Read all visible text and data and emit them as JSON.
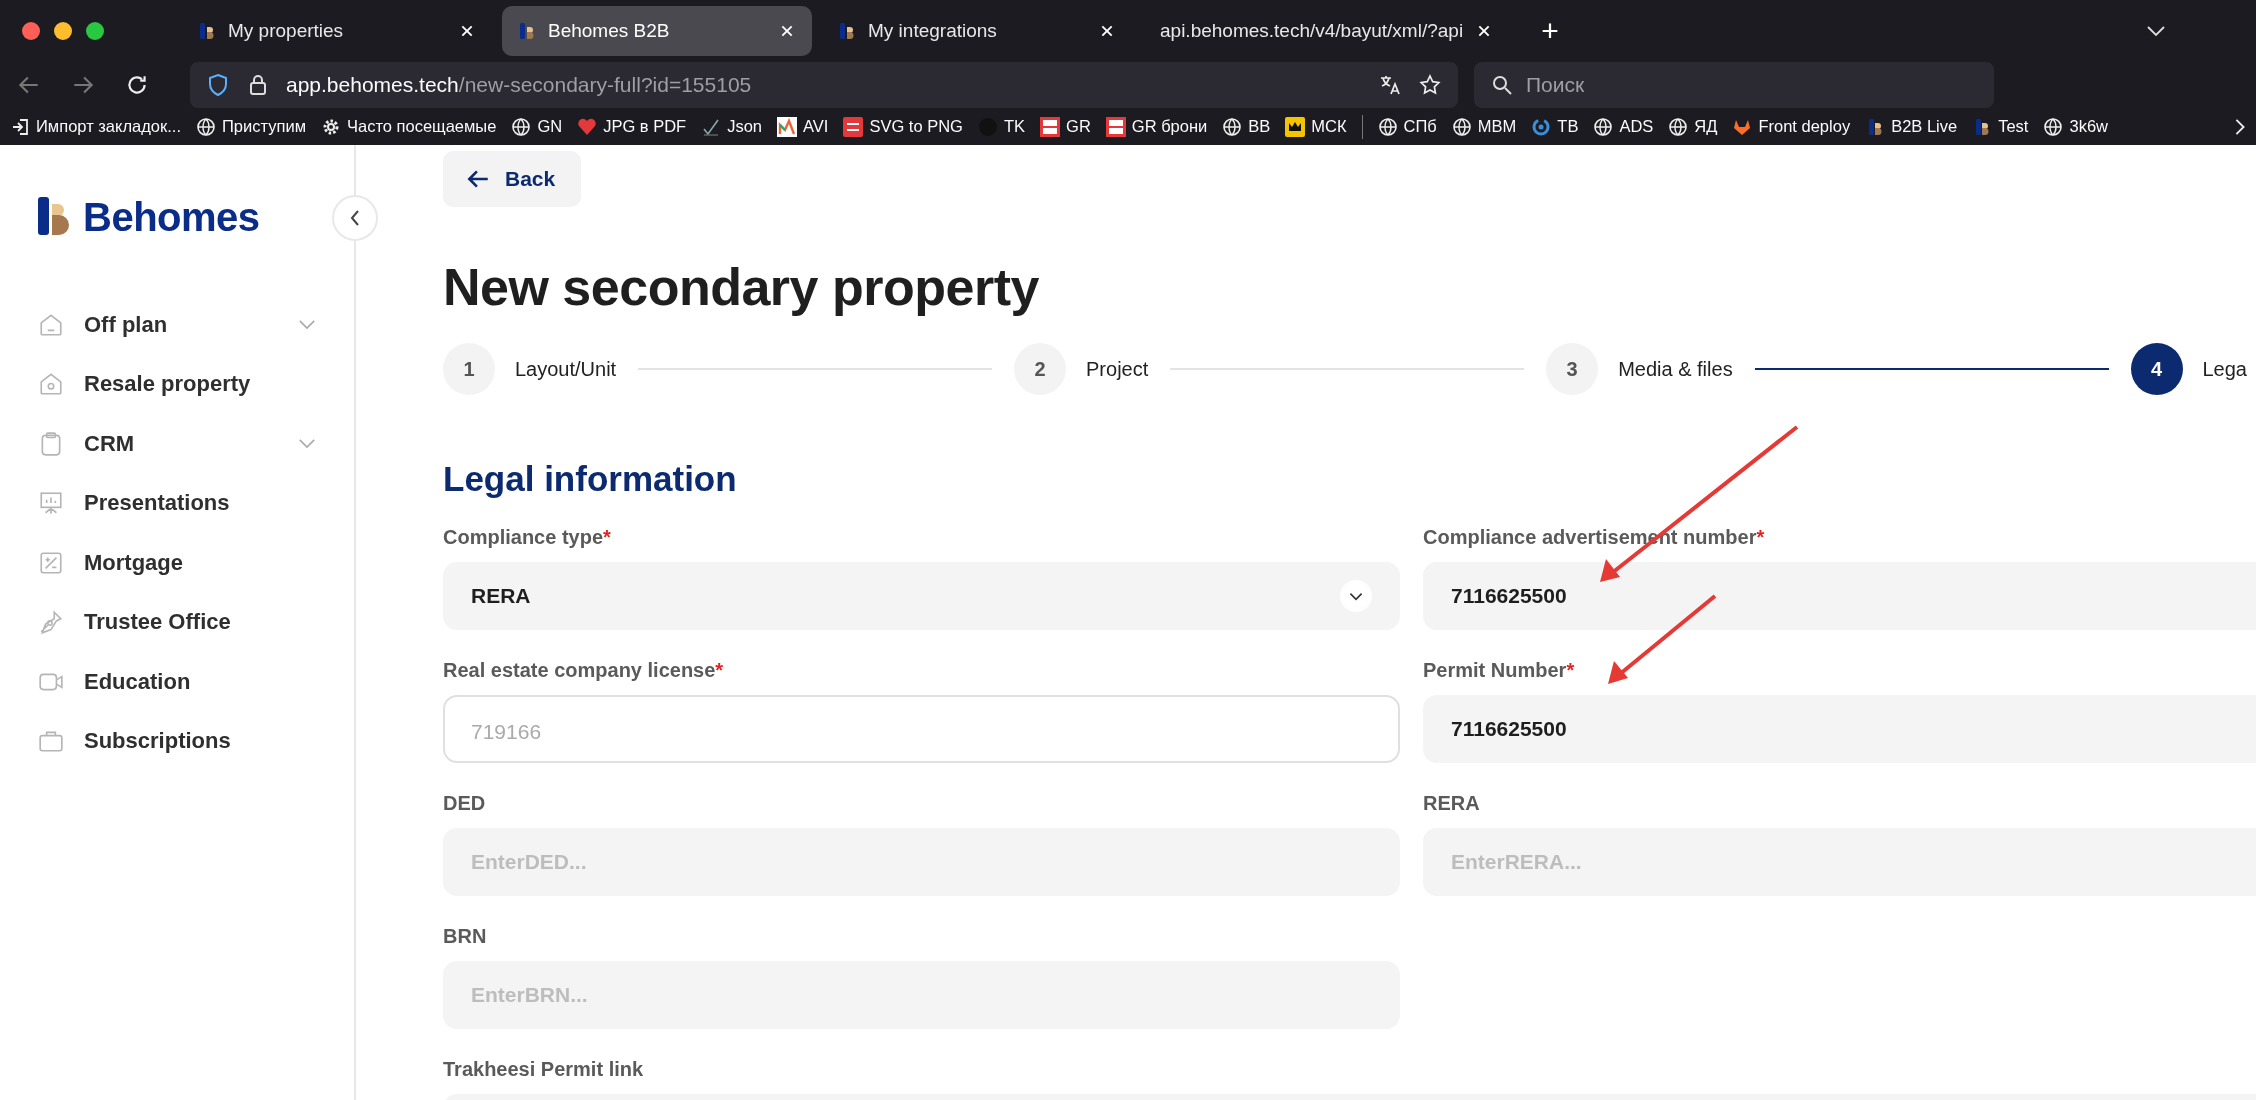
{
  "browser": {
    "tabs": [
      {
        "title": "My properties",
        "favicon": true,
        "selected": false
      },
      {
        "title": "Behomes B2B",
        "favicon": true,
        "selected": true
      },
      {
        "title": "My integrations",
        "favicon": true,
        "selected": false
      },
      {
        "title": "api.behomes.tech/v4/bayut/xml/?api",
        "favicon": false,
        "selected": false
      }
    ],
    "new_tab": "+",
    "url": {
      "host": "app.behomes.tech",
      "path": "/new-secondary-full?id=155105"
    },
    "search": {
      "placeholder": "Поиск"
    },
    "bookmarks": [
      {
        "kind": "import",
        "label": "Импорт закладок..."
      },
      {
        "kind": "globe",
        "label": "Приступим"
      },
      {
        "kind": "gear",
        "label": "Часто посещаемые"
      },
      {
        "kind": "globe",
        "label": "GN"
      },
      {
        "kind": "heart",
        "label": "JPG в PDF"
      },
      {
        "kind": "check",
        "label": "Json"
      },
      {
        "kind": "tiles",
        "label": "AVI"
      },
      {
        "kind": "svg",
        "label": "SVG to PNG"
      },
      {
        "kind": "circle",
        "label": "TK"
      },
      {
        "kind": "goru",
        "label": "GR"
      },
      {
        "kind": "goru",
        "label": "GR брони"
      },
      {
        "kind": "globe",
        "label": "BB"
      },
      {
        "kind": "crown",
        "label": "МСК"
      },
      {
        "kind": "separator"
      },
      {
        "kind": "globe",
        "label": "СПб"
      },
      {
        "kind": "globe",
        "label": "MBM"
      },
      {
        "kind": "sync",
        "label": "TB"
      },
      {
        "kind": "globe",
        "label": "ADS"
      },
      {
        "kind": "globe",
        "label": "ЯД"
      },
      {
        "kind": "fox",
        "label": "Front deploy"
      },
      {
        "kind": "logo",
        "label": "B2B Live"
      },
      {
        "kind": "logo",
        "label": "Test"
      },
      {
        "kind": "globe",
        "label": "3k6w"
      }
    ]
  },
  "sidebar": {
    "logo": "Behomes",
    "items": [
      {
        "kind": "house",
        "label": "Off plan",
        "expandable": true
      },
      {
        "kind": "house-circle",
        "label": "Resale property",
        "expandable": false
      },
      {
        "kind": "clipboard",
        "label": "CRM",
        "expandable": true
      },
      {
        "kind": "presentation",
        "label": "Presentations",
        "expandable": false
      },
      {
        "kind": "percent",
        "label": "Mortgage",
        "expandable": false
      },
      {
        "kind": "pen",
        "label": "Trustee Office",
        "expandable": false
      },
      {
        "kind": "video",
        "label": "Education",
        "expandable": false
      },
      {
        "kind": "briefcase",
        "label": "Subscriptions",
        "expandable": false
      }
    ]
  },
  "back_button": "Back",
  "title": "New secondary property",
  "steps": [
    {
      "number": "1",
      "label": "Layout/Unit",
      "selected": false
    },
    {
      "number": "2",
      "label": "Project",
      "selected": false
    },
    {
      "number": "3",
      "label": "Media & files",
      "selected": false
    },
    {
      "number": "4",
      "label": "Lega",
      "selected": true
    }
  ],
  "section_title": "Legal information",
  "fields": [
    {
      "kind": "select",
      "label": "Compliance type",
      "required_mark": "*",
      "value": "RERA",
      "focused": false
    },
    {
      "kind": "input",
      "label": "Compliance advertisement number",
      "required_mark": "*",
      "value": "7116625500",
      "focused": false
    },
    {
      "kind": "input",
      "label": "Real estate company license",
      "required_mark": "*",
      "placeholder": "719166",
      "focused": true
    },
    {
      "kind": "input",
      "label": "Permit Number",
      "required_mark": "*",
      "value": "7116625500",
      "focused": false
    },
    {
      "kind": "input",
      "label": "DED",
      "placeholder": "EnterDED...",
      "focused": false
    },
    {
      "kind": "input",
      "label": "RERA",
      "placeholder": "EnterRERA...",
      "focused": false
    },
    {
      "kind": "input",
      "label": "BRN",
      "placeholder": "EnterBRN...",
      "focused": false
    },
    {
      "kind": "spacer"
    },
    {
      "kind": "wide",
      "label": "Trakheesi Permit link",
      "focused": false
    }
  ]
}
